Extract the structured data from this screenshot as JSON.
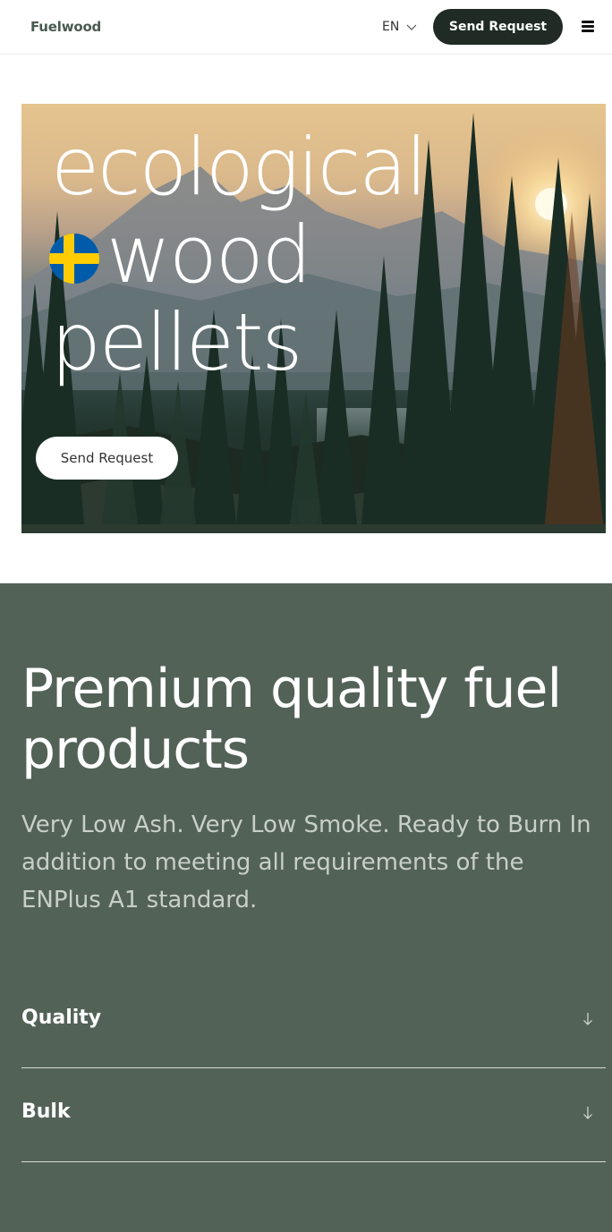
{
  "header": {
    "logo": "Fuelwood",
    "language": "EN",
    "send_request_label": "Send Request",
    "menu_icon": "hamburger-menu-icon"
  },
  "hero": {
    "title_line1": "ecological",
    "title_line2": "wood",
    "title_line3": "pellets",
    "flag_icon": "sweden-flag-icon",
    "button_label": "Send Request"
  },
  "section": {
    "title": "Premium quality fuel products",
    "subtitle": "Very Low Ash. Very Low Smoke. Ready to Burn In addition to meeting all requirements of the ENPlus A1 standard.",
    "accordion": [
      {
        "label": "Quality",
        "icon": "arrow-down-icon"
      },
      {
        "label": "Bulk",
        "icon": "arrow-down-icon"
      }
    ]
  },
  "colors": {
    "header_button_bg": "#1f2b24",
    "section_bg": "#536257",
    "flag_blue": "#005baa",
    "flag_yellow": "#fecc02"
  }
}
